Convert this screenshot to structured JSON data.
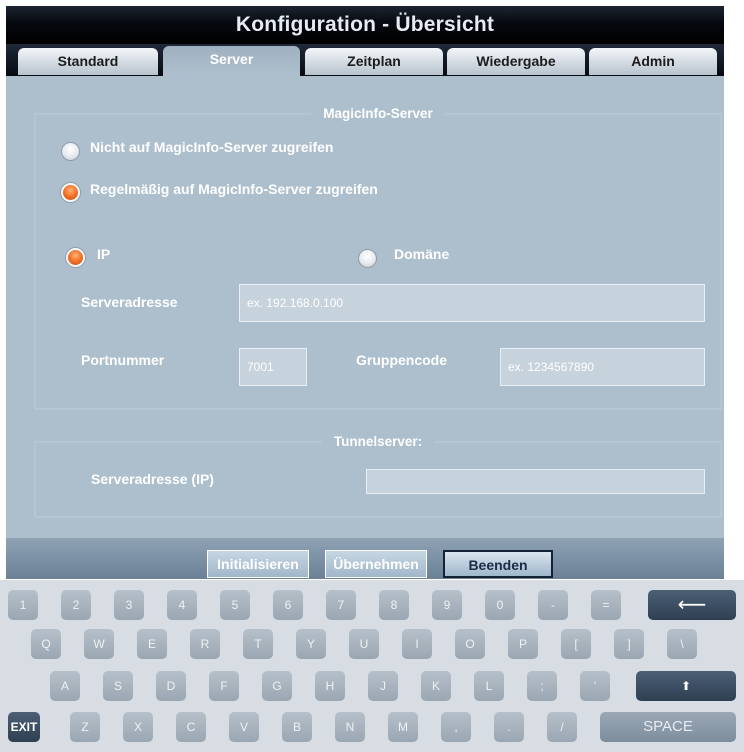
{
  "window": {
    "title": "Konfiguration - Übersicht"
  },
  "tabs": [
    {
      "label": "Standard",
      "active": false
    },
    {
      "label": "Server",
      "active": true
    },
    {
      "label": "Zeitplan",
      "active": false
    },
    {
      "label": "Wiedergabe",
      "active": false
    },
    {
      "label": "Admin",
      "active": false
    }
  ],
  "magicinfo": {
    "legend": "MagicInfo-Server",
    "option_no_access": "Nicht auf MagicInfo-Server zugreifen",
    "option_regular_access": "Regelmäßig auf MagicInfo-Server zugreifen",
    "selected_access": "regular",
    "mode_ip": "IP",
    "mode_domain": "Domäne",
    "selected_mode": "ip",
    "server_address_label": "Serveradresse",
    "server_address_placeholder": "ex. 192.168.0.100",
    "port_label": "Portnummer",
    "port_value": "7001",
    "group_code_label": "Gruppencode",
    "group_code_placeholder": "ex. 1234567890"
  },
  "tunnel": {
    "legend": "Tunnelserver:",
    "server_address_label": "Serveradresse (IP)",
    "server_address_value": ""
  },
  "buttons": {
    "initialize": "Initialisieren",
    "apply": "Übernehmen",
    "exit": "Beenden"
  },
  "keyboard": {
    "row1": [
      "1",
      "2",
      "3",
      "4",
      "5",
      "6",
      "7",
      "8",
      "9",
      "0",
      "-",
      "="
    ],
    "backspace": "⟵",
    "row2": [
      "Q",
      "W",
      "E",
      "R",
      "T",
      "Y",
      "U",
      "I",
      "O",
      "P",
      "[",
      "]",
      "\\"
    ],
    "row3": [
      "A",
      "S",
      "D",
      "F",
      "G",
      "H",
      "J",
      "K",
      "L",
      ";",
      "'"
    ],
    "shift": "⬆",
    "exit": "EXIT",
    "row4": [
      "Z",
      "X",
      "C",
      "V",
      "B",
      "N",
      "M",
      ",",
      ".",
      "/"
    ],
    "space": "SPACE"
  },
  "colors": {
    "accent_selected_radio": "#f37226",
    "panel_bg": "#adbfcc",
    "keyboard_bg": "#d7dde3"
  }
}
